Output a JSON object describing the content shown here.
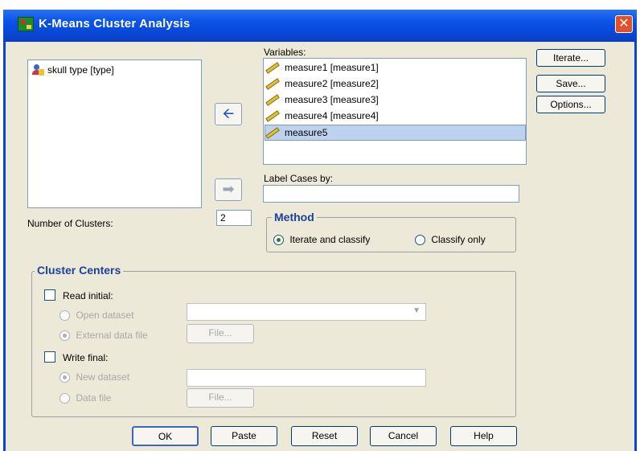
{
  "window": {
    "title": "K-Means Cluster Analysis",
    "close_glyph": "✕"
  },
  "source_list": {
    "items": [
      {
        "label": "skull type [type]",
        "icon": "nominal-variable-icon"
      }
    ]
  },
  "variables": {
    "label": "Variables:",
    "items": [
      {
        "label": "measure1 [measure1]",
        "icon": "scale-ruler-icon",
        "selected": false
      },
      {
        "label": "measure2 [measure2]",
        "icon": "scale-ruler-icon",
        "selected": false
      },
      {
        "label": "measure3 [measure3]",
        "icon": "scale-ruler-icon",
        "selected": false
      },
      {
        "label": "measure4 [measure4]",
        "icon": "scale-ruler-icon",
        "selected": false
      },
      {
        "label": "measure5",
        "icon": "scale-ruler-icon",
        "selected": true
      }
    ]
  },
  "label_cases": {
    "label": "Label Cases by:",
    "value": ""
  },
  "transfer": {
    "to_variables_glyph": "🡨",
    "to_label_glyph": "➡"
  },
  "side_buttons": {
    "iterate": "Iterate...",
    "save": "Save...",
    "options": "Options..."
  },
  "clusters": {
    "label": "Number of Clusters:",
    "value": "2"
  },
  "method": {
    "legend": "Method",
    "iterate_classify": "Iterate and classify",
    "classify_only": "Classify only",
    "selected": "iterate_classify"
  },
  "cluster_centers": {
    "legend": "Cluster Centers",
    "read_initial": "Read initial:",
    "open_dataset": "Open dataset",
    "external_file": "External data file",
    "file_button": "File...",
    "write_final": "Write final:",
    "new_dataset": "New dataset",
    "data_file": "Data file"
  },
  "footer": {
    "ok": "OK",
    "paste": "Paste",
    "reset": "Reset",
    "cancel": "Cancel",
    "help": "Help"
  },
  "colors": {
    "titlebar": "#0b54e8",
    "dialog_bg": "#ece9d8",
    "selection": "#bcd2ee",
    "legend_text": "#1b42a0"
  }
}
